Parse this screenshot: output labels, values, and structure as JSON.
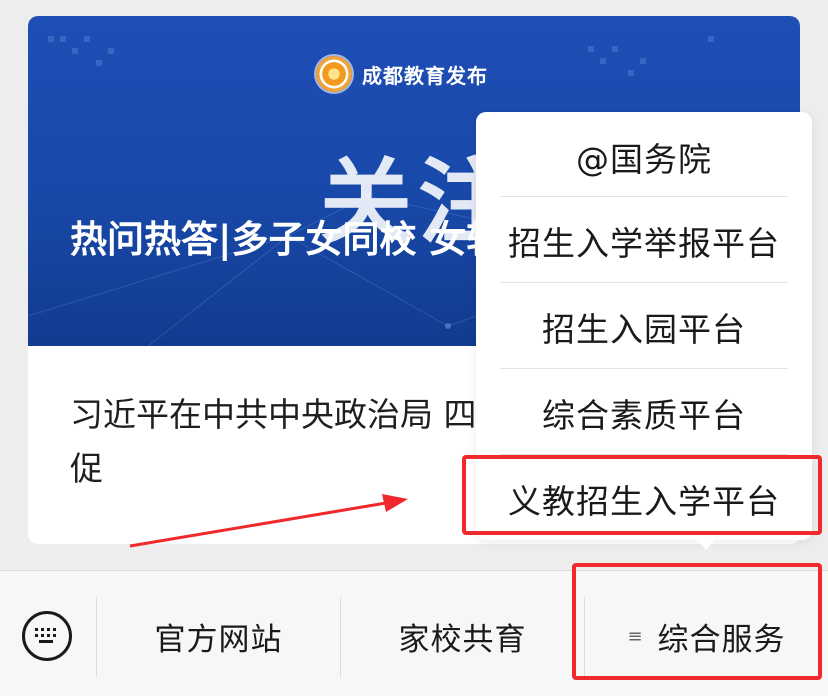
{
  "article": {
    "brand": "成都教育发布",
    "banner_big_text": "关注",
    "banner_title": "热问热答|多子女同校 女转学",
    "summary": "习近平在中共中央政治局 四次集体学习时强调 促"
  },
  "popup_menu": {
    "items": [
      "@国务院",
      "招生入学举报平台",
      "招生入园平台",
      "综合素质平台",
      "义教招生入学平台"
    ],
    "highlighted_item": "义教招生入学平台"
  },
  "bottom_bar": {
    "keyboard_icon": "keyboard-icon",
    "tabs": [
      "官方网站",
      "家校共育",
      "综合服务"
    ],
    "menu_glyph": "≡",
    "active_tab": "综合服务"
  },
  "colors": {
    "annotation_red": "#f0292d",
    "banner_blue": "#1f4fb6",
    "background": "#ededed"
  }
}
